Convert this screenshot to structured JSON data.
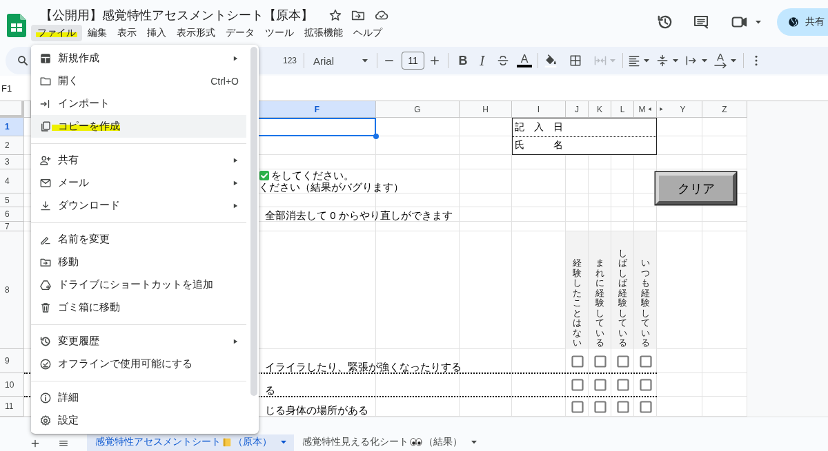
{
  "app": {
    "title": "【公開用】感覚特性アセスメントシート【原本】"
  },
  "menubar": [
    {
      "label": "ファイル",
      "selected": true,
      "marker": true
    },
    {
      "label": "編集",
      "selected": false,
      "marker": false
    },
    {
      "label": "表示",
      "selected": false,
      "marker": false
    },
    {
      "label": "挿入",
      "selected": false,
      "marker": false
    },
    {
      "label": "表示形式",
      "selected": false,
      "marker": false
    },
    {
      "label": "データ",
      "selected": false,
      "marker": false
    },
    {
      "label": "ツール",
      "selected": false,
      "marker": false
    },
    {
      "label": "拡張機能",
      "selected": false,
      "marker": false
    },
    {
      "label": "ヘルプ",
      "selected": false,
      "marker": false
    }
  ],
  "share": {
    "label": "共有"
  },
  "toolbar": {
    "format_label": "123",
    "font": "Arial",
    "font_size": "11",
    "bold_label": "B",
    "italic_label": "I",
    "text_color_label": "A",
    "rotate_label": "A",
    "merge_disabled": true
  },
  "name_box": "F1",
  "columns": [
    {
      "label": "F",
      "selected": true
    },
    {
      "label": "G",
      "selected": false
    },
    {
      "label": "H",
      "selected": false
    },
    {
      "label": "I",
      "selected": false
    },
    {
      "label": "J",
      "selected": false
    },
    {
      "label": "K",
      "selected": false
    },
    {
      "label": "L",
      "selected": false
    },
    {
      "label": "M",
      "selected": false
    },
    {
      "label": "Y",
      "selected": false
    },
    {
      "label": "Z",
      "selected": false
    }
  ],
  "rows": [
    {
      "label": "1",
      "selected": true
    },
    {
      "label": "2",
      "selected": false
    },
    {
      "label": "3",
      "selected": false
    },
    {
      "label": "4",
      "selected": false,
      "texts": [
        {
          "kind": "check",
          "text": "をしてください。"
        },
        {
          "kind": "plain",
          "text": "ください（結果がバグります）"
        }
      ]
    },
    {
      "label": "5",
      "selected": false
    },
    {
      "label": "6",
      "selected": false,
      "texts": [
        {
          "kind": "plain",
          "text": "全部消去して 0 からやり直しができます"
        }
      ]
    },
    {
      "label": "7",
      "selected": false
    },
    {
      "label": "8",
      "selected": false,
      "scale_headers": [
        "経験したことはない",
        "まれに経験している",
        "しばしば経験している",
        "いつも経験している"
      ]
    },
    {
      "label": "9",
      "selected": false,
      "texts": [
        {
          "kind": "plain",
          "text": "イライラしたり、緊張が強くなったりする"
        }
      ],
      "checks": [
        {
          "checked": false
        },
        {
          "checked": false
        },
        {
          "checked": false
        },
        {
          "checked": false
        }
      ],
      "dotted_border": true
    },
    {
      "label": "10",
      "selected": false,
      "texts": [
        {
          "kind": "plain",
          "text": "る"
        }
      ],
      "checks": [
        {
          "checked": false
        },
        {
          "checked": false
        },
        {
          "checked": false
        },
        {
          "checked": false
        }
      ],
      "dotted_border": true
    },
    {
      "label": "11",
      "selected": false,
      "texts": [
        {
          "kind": "plain",
          "text": "じる身体の場所がある"
        }
      ],
      "checks": [
        {
          "checked": false
        },
        {
          "checked": false
        },
        {
          "checked": false
        },
        {
          "checked": false
        }
      ],
      "dotted_border": false
    }
  ],
  "form": {
    "labels": [
      "記入日",
      "氏名"
    ]
  },
  "clear_button": {
    "label": "クリア"
  },
  "file_menu": [
    {
      "kind": "item",
      "label": "新規作成",
      "submenu": true,
      "selected": false,
      "marker": false
    },
    {
      "kind": "item",
      "label": "開く",
      "shortcut": "Ctrl+O",
      "submenu": false,
      "selected": false,
      "marker": false
    },
    {
      "kind": "item",
      "label": "インポート",
      "submenu": false,
      "selected": false,
      "marker": false
    },
    {
      "kind": "item",
      "label": "コピーを作成",
      "submenu": false,
      "selected": true,
      "marker": true
    },
    {
      "kind": "divider"
    },
    {
      "kind": "item",
      "label": "共有",
      "submenu": true,
      "selected": false,
      "marker": false
    },
    {
      "kind": "item",
      "label": "メール",
      "submenu": true,
      "selected": false,
      "marker": false
    },
    {
      "kind": "item",
      "label": "ダウンロード",
      "submenu": true,
      "selected": false,
      "marker": false
    },
    {
      "kind": "divider"
    },
    {
      "kind": "item",
      "label": "名前を変更",
      "submenu": false,
      "selected": false,
      "marker": false
    },
    {
      "kind": "item",
      "label": "移動",
      "submenu": false,
      "selected": false,
      "marker": false
    },
    {
      "kind": "item",
      "label": "ドライブにショートカットを追加",
      "submenu": false,
      "selected": false,
      "marker": false
    },
    {
      "kind": "item",
      "label": "ゴミ箱に移動",
      "submenu": false,
      "selected": false,
      "marker": false
    },
    {
      "kind": "divider"
    },
    {
      "kind": "item",
      "label": "変更履歴",
      "submenu": true,
      "selected": false,
      "marker": false
    },
    {
      "kind": "item",
      "label": "オフラインで使用可能にする",
      "submenu": false,
      "selected": false,
      "marker": false
    },
    {
      "kind": "divider"
    },
    {
      "kind": "item",
      "label": "詳細",
      "submenu": false,
      "selected": false,
      "marker": false
    },
    {
      "kind": "item",
      "label": "設定",
      "submenu": false,
      "selected": false,
      "marker": false
    }
  ],
  "sheet_tabs": [
    {
      "label": "感覚特性アセスメントシート",
      "suffix": "（原本）",
      "selected": true
    },
    {
      "label": "感覚特性見える化シート",
      "suffix": "（結果）",
      "selected": false
    }
  ]
}
